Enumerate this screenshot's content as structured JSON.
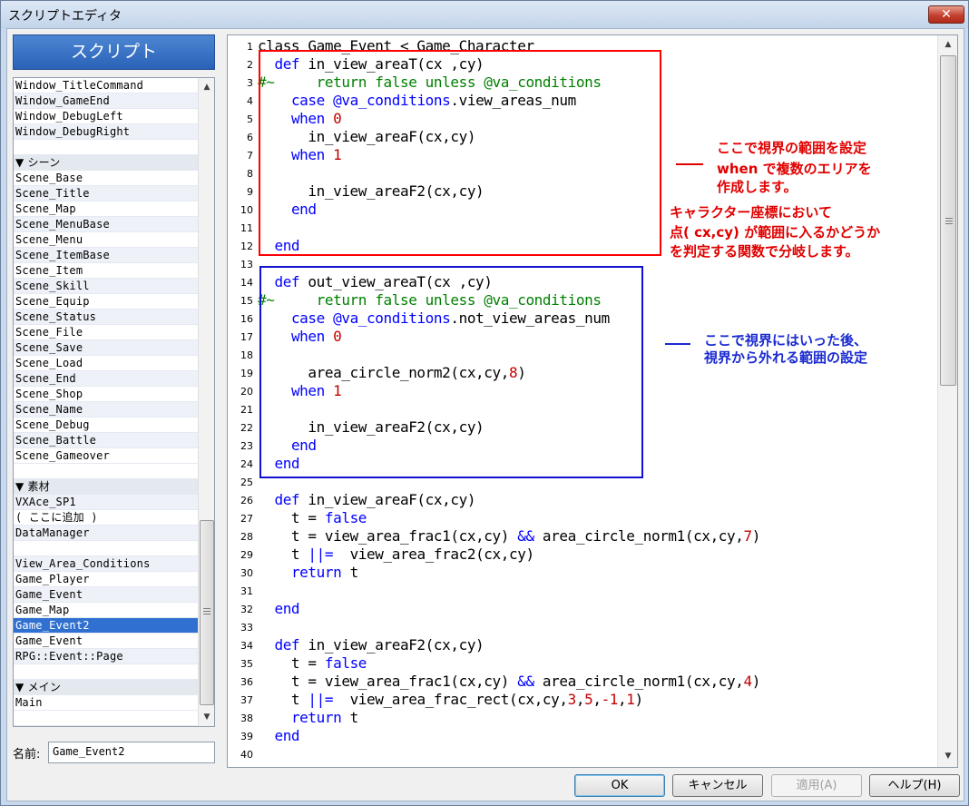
{
  "window": {
    "title": "スクリプトエディタ",
    "close_icon": "✕"
  },
  "sidebar": {
    "header": "スクリプト",
    "items": [
      {
        "label": "Window_TitleCommand"
      },
      {
        "label": "Window_GameEnd"
      },
      {
        "label": "Window_DebugLeft"
      },
      {
        "label": "Window_DebugRight"
      },
      {
        "label": ""
      },
      {
        "label": "▼ シーン",
        "section": true
      },
      {
        "label": "Scene_Base"
      },
      {
        "label": "Scene_Title"
      },
      {
        "label": "Scene_Map"
      },
      {
        "label": "Scene_MenuBase"
      },
      {
        "label": "Scene_Menu"
      },
      {
        "label": "Scene_ItemBase"
      },
      {
        "label": "Scene_Item"
      },
      {
        "label": "Scene_Skill"
      },
      {
        "label": "Scene_Equip"
      },
      {
        "label": "Scene_Status"
      },
      {
        "label": "Scene_File"
      },
      {
        "label": "Scene_Save"
      },
      {
        "label": "Scene_Load"
      },
      {
        "label": "Scene_End"
      },
      {
        "label": "Scene_Shop"
      },
      {
        "label": "Scene_Name"
      },
      {
        "label": "Scene_Debug"
      },
      {
        "label": "Scene_Battle"
      },
      {
        "label": "Scene_Gameover"
      },
      {
        "label": ""
      },
      {
        "label": "▼ 素材",
        "section": true
      },
      {
        "label": "VXAce_SP1"
      },
      {
        "label": "( ここに追加 )"
      },
      {
        "label": "DataManager"
      },
      {
        "label": ""
      },
      {
        "label": "View_Area_Conditions"
      },
      {
        "label": "Game_Player"
      },
      {
        "label": "Game_Event"
      },
      {
        "label": "Game_Map"
      },
      {
        "label": "Game_Event2",
        "selected": true
      },
      {
        "label": "Game_Event"
      },
      {
        "label": "RPG::Event::Page"
      },
      {
        "label": ""
      },
      {
        "label": "▼ メイン",
        "section": true
      },
      {
        "label": "Main"
      },
      {
        "label": ""
      }
    ]
  },
  "name_field": {
    "label": "名前:",
    "value": "Game_Event2"
  },
  "editor": {
    "lines": [
      {
        "n": "1",
        "tokens": [
          [
            "class Game_Event < Game_Character",
            ""
          ]
        ]
      },
      {
        "n": "2",
        "tokens": [
          [
            "  ",
            ""
          ],
          [
            "def",
            "kw"
          ],
          [
            " in_view_areaT(cx ,cy)",
            ""
          ]
        ]
      },
      {
        "n": "3",
        "tokens": [
          [
            "#~     return false unless @va_conditions",
            "cm"
          ]
        ]
      },
      {
        "n": "4",
        "tokens": [
          [
            "    ",
            ""
          ],
          [
            "case",
            "kw"
          ],
          [
            " ",
            ""
          ],
          [
            "@va_conditions",
            "iv"
          ],
          [
            ".view_areas_num",
            ""
          ]
        ]
      },
      {
        "n": "5",
        "tokens": [
          [
            "    ",
            ""
          ],
          [
            "when",
            "kw"
          ],
          [
            " ",
            ""
          ],
          [
            "0",
            "num"
          ]
        ]
      },
      {
        "n": "6",
        "tokens": [
          [
            "      in_view_areaF(cx,cy)",
            ""
          ]
        ]
      },
      {
        "n": "7",
        "tokens": [
          [
            "    ",
            ""
          ],
          [
            "when",
            "kw"
          ],
          [
            " ",
            ""
          ],
          [
            "1",
            "num"
          ]
        ]
      },
      {
        "n": "8",
        "tokens": [
          [
            "",
            ""
          ]
        ]
      },
      {
        "n": "9",
        "tokens": [
          [
            "      in_view_areaF2(cx,cy)",
            ""
          ]
        ]
      },
      {
        "n": "10",
        "tokens": [
          [
            "    ",
            ""
          ],
          [
            "end",
            "kw"
          ]
        ]
      },
      {
        "n": "11",
        "tokens": [
          [
            "",
            ""
          ]
        ]
      },
      {
        "n": "12",
        "tokens": [
          [
            "  ",
            ""
          ],
          [
            "end",
            "kw"
          ]
        ]
      },
      {
        "n": "13",
        "tokens": [
          [
            "",
            ""
          ]
        ]
      },
      {
        "n": "14",
        "tokens": [
          [
            "  ",
            ""
          ],
          [
            "def",
            "kw"
          ],
          [
            " out_view_areaT(cx ,cy)",
            ""
          ]
        ]
      },
      {
        "n": "15",
        "tokens": [
          [
            "#~     return false unless @va_conditions",
            "cm"
          ]
        ]
      },
      {
        "n": "16",
        "tokens": [
          [
            "    ",
            ""
          ],
          [
            "case",
            "kw"
          ],
          [
            " ",
            ""
          ],
          [
            "@va_conditions",
            "iv"
          ],
          [
            ".not_view_areas_num",
            ""
          ]
        ]
      },
      {
        "n": "17",
        "tokens": [
          [
            "    ",
            ""
          ],
          [
            "when",
            "kw"
          ],
          [
            " ",
            ""
          ],
          [
            "0",
            "num"
          ]
        ]
      },
      {
        "n": "18",
        "tokens": [
          [
            "",
            ""
          ]
        ]
      },
      {
        "n": "19",
        "tokens": [
          [
            "      area_circle_norm2(cx,cy,",
            ""
          ],
          [
            "8",
            "num"
          ],
          [
            ")",
            ""
          ]
        ]
      },
      {
        "n": "20",
        "tokens": [
          [
            "    ",
            ""
          ],
          [
            "when",
            "kw"
          ],
          [
            " ",
            ""
          ],
          [
            "1",
            "num"
          ]
        ]
      },
      {
        "n": "21",
        "tokens": [
          [
            "",
            ""
          ]
        ]
      },
      {
        "n": "22",
        "tokens": [
          [
            "      in_view_areaF2(cx,cy)",
            ""
          ]
        ]
      },
      {
        "n": "23",
        "tokens": [
          [
            "    ",
            ""
          ],
          [
            "end",
            "kw"
          ]
        ]
      },
      {
        "n": "24",
        "tokens": [
          [
            "  ",
            ""
          ],
          [
            "end",
            "kw"
          ]
        ]
      },
      {
        "n": "25",
        "tokens": [
          [
            "",
            ""
          ]
        ]
      },
      {
        "n": "26",
        "tokens": [
          [
            "  ",
            ""
          ],
          [
            "def",
            "kw"
          ],
          [
            " in_view_areaF(cx,cy)",
            ""
          ]
        ]
      },
      {
        "n": "27",
        "tokens": [
          [
            "    t = ",
            ""
          ],
          [
            "false",
            "kw"
          ]
        ]
      },
      {
        "n": "28",
        "tokens": [
          [
            "    t = view_area_frac1(cx,cy) ",
            ""
          ],
          [
            "&&",
            "kw"
          ],
          [
            " area_circle_norm1(cx,cy,",
            ""
          ],
          [
            "7",
            "num"
          ],
          [
            ")",
            ""
          ]
        ]
      },
      {
        "n": "29",
        "tokens": [
          [
            "    t ",
            ""
          ],
          [
            "||=",
            "kw"
          ],
          [
            "  view_area_frac2(cx,cy)",
            ""
          ]
        ]
      },
      {
        "n": "30",
        "tokens": [
          [
            "    ",
            ""
          ],
          [
            "return",
            "kw"
          ],
          [
            " t",
            ""
          ]
        ]
      },
      {
        "n": "31",
        "tokens": [
          [
            "",
            ""
          ]
        ]
      },
      {
        "n": "32",
        "tokens": [
          [
            "  ",
            ""
          ],
          [
            "end",
            "kw"
          ]
        ]
      },
      {
        "n": "33",
        "tokens": [
          [
            "",
            ""
          ]
        ]
      },
      {
        "n": "34",
        "tokens": [
          [
            "  ",
            ""
          ],
          [
            "def",
            "kw"
          ],
          [
            " in_view_areaF2(cx,cy)",
            ""
          ]
        ]
      },
      {
        "n": "35",
        "tokens": [
          [
            "    t = ",
            ""
          ],
          [
            "false",
            "kw"
          ]
        ]
      },
      {
        "n": "36",
        "tokens": [
          [
            "    t = view_area_frac1(cx,cy) ",
            ""
          ],
          [
            "&&",
            "kw"
          ],
          [
            " area_circle_norm1(cx,cy,",
            ""
          ],
          [
            "4",
            "num"
          ],
          [
            ")",
            ""
          ]
        ]
      },
      {
        "n": "37",
        "tokens": [
          [
            "    t ",
            ""
          ],
          [
            "||=",
            "kw"
          ],
          [
            "  view_area_frac_rect(cx,cy,",
            ""
          ],
          [
            "3",
            "num"
          ],
          [
            ",",
            ""
          ],
          [
            "5",
            "num"
          ],
          [
            ",",
            ""
          ],
          [
            "-1",
            "num"
          ],
          [
            ",",
            ""
          ],
          [
            "1",
            "num"
          ],
          [
            ")",
            ""
          ]
        ]
      },
      {
        "n": "38",
        "tokens": [
          [
            "    ",
            ""
          ],
          [
            "return",
            "kw"
          ],
          [
            " t",
            ""
          ]
        ]
      },
      {
        "n": "39",
        "tokens": [
          [
            "  ",
            ""
          ],
          [
            "end",
            "kw"
          ]
        ]
      },
      {
        "n": "40",
        "tokens": [
          [
            "",
            ""
          ]
        ]
      }
    ]
  },
  "annotations": {
    "red_1": "ここで視界の範囲を設定",
    "red_2": "when で複数のエリアを",
    "red_3": "作成します。",
    "red_4": "キャラクター座標において",
    "red_5": "点( cx,cy) が範囲に入るかどうか",
    "red_6": "を判定する関数で分岐します。",
    "blue_1": "ここで視界にはいった後、",
    "blue_2": "視界から外れる範囲の設定"
  },
  "buttons": {
    "ok": "OK",
    "cancel": "キャンセル",
    "apply": "適用(A)",
    "help": "ヘルプ(H)"
  },
  "colors": {
    "red_box": "#ff0000",
    "blue_box": "#1010d0",
    "red_text": "#e00000",
    "blue_text": "#1a2ad0",
    "selection": "#3070d0"
  }
}
